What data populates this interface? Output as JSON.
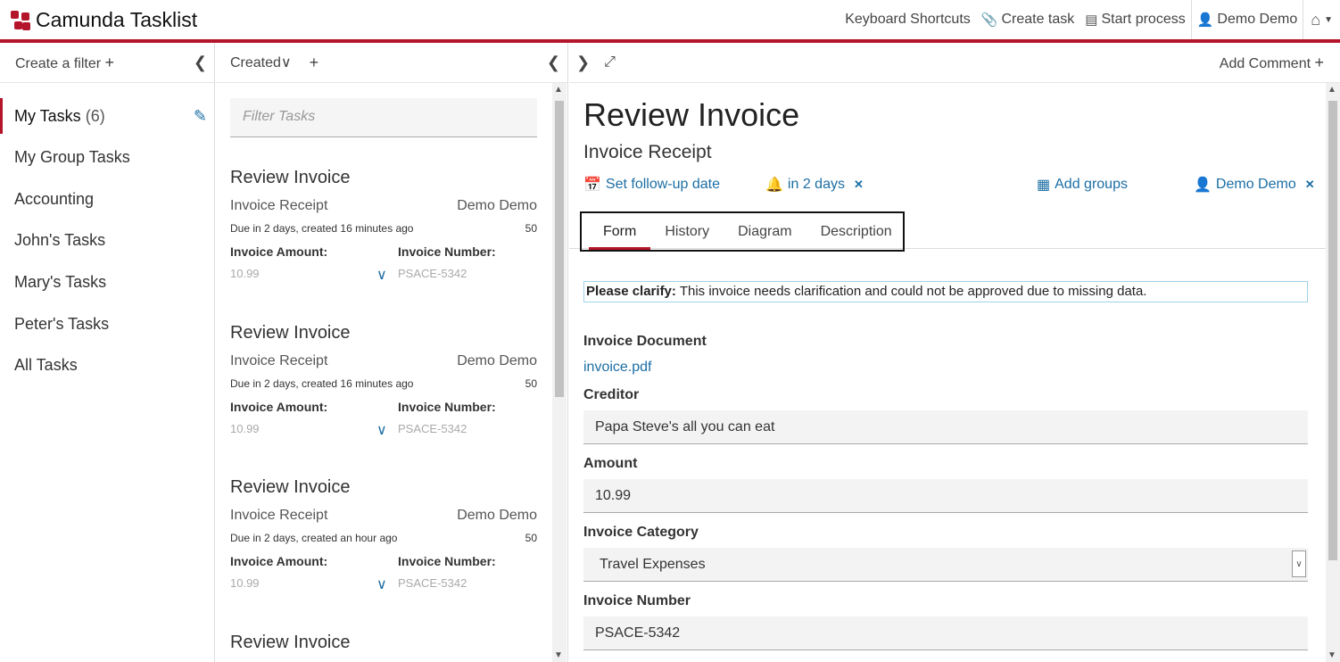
{
  "header": {
    "title": "Camunda Tasklist",
    "shortcuts": "Keyboard Shortcuts",
    "create_task": "Create task",
    "start_process": "Start process",
    "user": "Demo Demo",
    "icons": {
      "brand": "camunda-logo",
      "create": "paperclip-icon",
      "start": "list-icon",
      "user": "user-icon",
      "home": "home-icon"
    },
    "accent": "#b5152b"
  },
  "filters": {
    "create_label": "Create a filter",
    "items": [
      {
        "label": "My Tasks",
        "count": "(6)"
      },
      {
        "label": "My Group Tasks"
      },
      {
        "label": "Accounting"
      },
      {
        "label": "John's Tasks"
      },
      {
        "label": "Mary's Tasks"
      },
      {
        "label": "Peter's Tasks"
      },
      {
        "label": "All Tasks"
      }
    ]
  },
  "tasklist": {
    "sort_label": "Created",
    "search_placeholder": "Filter Tasks",
    "cards": [
      {
        "title": "Review Invoice",
        "process": "Invoice Receipt",
        "assignee": "Demo Demo",
        "due": "Due in 2 days, created 16 minutes ago",
        "priority": "50",
        "amount_label": "Invoice Amount:",
        "amount": "10.99",
        "number_label": "Invoice Number:",
        "number": "PSACE-5342"
      },
      {
        "title": "Review Invoice",
        "process": "Invoice Receipt",
        "assignee": "Demo Demo",
        "due": "Due in 2 days, created 16 minutes ago",
        "priority": "50",
        "amount_label": "Invoice Amount:",
        "amount": "10.99",
        "number_label": "Invoice Number:",
        "number": "PSACE-5342"
      },
      {
        "title": "Review Invoice",
        "process": "Invoice Receipt",
        "assignee": "Demo Demo",
        "due": "Due in 2 days, created an hour ago",
        "priority": "50",
        "amount_label": "Invoice Amount:",
        "amount": "10.99",
        "number_label": "Invoice Number:",
        "number": "PSACE-5342"
      },
      {
        "title": "Review Invoice"
      }
    ]
  },
  "task": {
    "add_comment": "Add Comment",
    "title": "Review Invoice",
    "process": "Invoice Receipt",
    "follow_up": "Set follow-up date",
    "due": "in 2 days",
    "add_groups": "Add groups",
    "assignee": "Demo Demo",
    "tabs": [
      "Form",
      "History",
      "Diagram",
      "Description"
    ],
    "form": {
      "clarify_label": "Please clarify:",
      "clarify_text": "This invoice needs clarification and could not be approved due to missing data.",
      "document_label": "Invoice Document",
      "document_link": "invoice.pdf",
      "creditor_label": "Creditor",
      "creditor": "Papa Steve's all you can eat",
      "amount_label": "Amount",
      "amount": "10.99",
      "category_label": "Invoice Category",
      "category": "Travel Expenses",
      "number_label": "Invoice Number",
      "number": "PSACE-5342"
    }
  }
}
